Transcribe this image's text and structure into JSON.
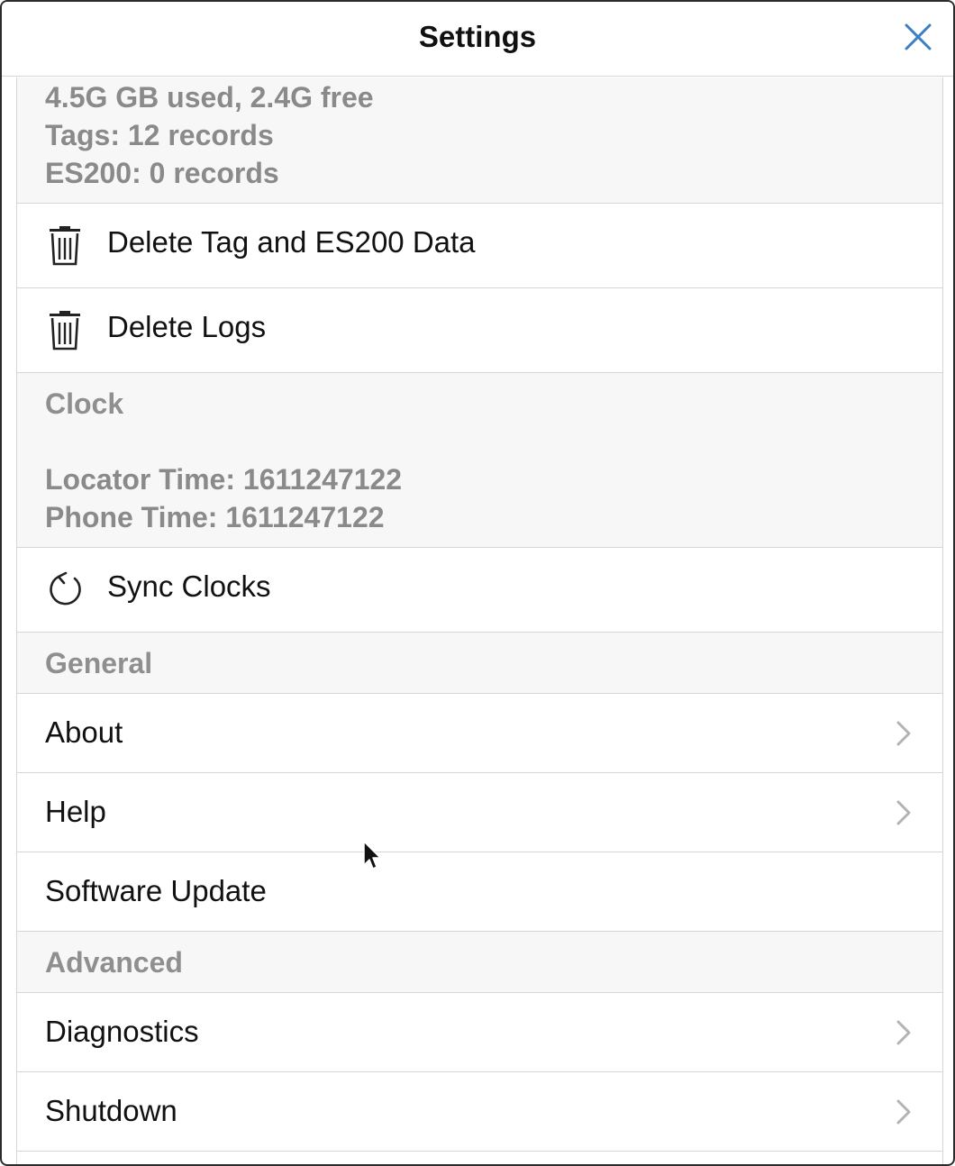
{
  "window": {
    "title": "Settings"
  },
  "storage": {
    "lines": [
      "4.5G GB used, 2.4G free",
      "Tags: 12 records",
      "ES200: 0 records"
    ]
  },
  "actions": {
    "delete_tag_data": "Delete Tag and ES200 Data",
    "delete_logs": "Delete Logs"
  },
  "clock": {
    "header": "Clock",
    "locator_time": "Locator Time: 1611247122",
    "phone_time": "Phone Time: 1611247122",
    "sync_label": "Sync Clocks"
  },
  "general": {
    "header": "General",
    "items": [
      {
        "label": "About",
        "chevron": true
      },
      {
        "label": "Help",
        "chevron": true
      },
      {
        "label": "Software Update",
        "chevron": false
      }
    ]
  },
  "advanced": {
    "header": "Advanced",
    "items": [
      {
        "label": "Diagnostics",
        "chevron": true
      },
      {
        "label": "Shutdown",
        "chevron": true
      }
    ]
  },
  "icons": {
    "close": "close-icon",
    "trash": "trash-icon",
    "sync": "sync-icon",
    "chevron": "chevron-right-icon"
  },
  "colors": {
    "accent": "#3b7fc4",
    "section_text": "#8f8f8f",
    "info_bg": "#f7f7f7",
    "divider": "#d6d6d6"
  }
}
